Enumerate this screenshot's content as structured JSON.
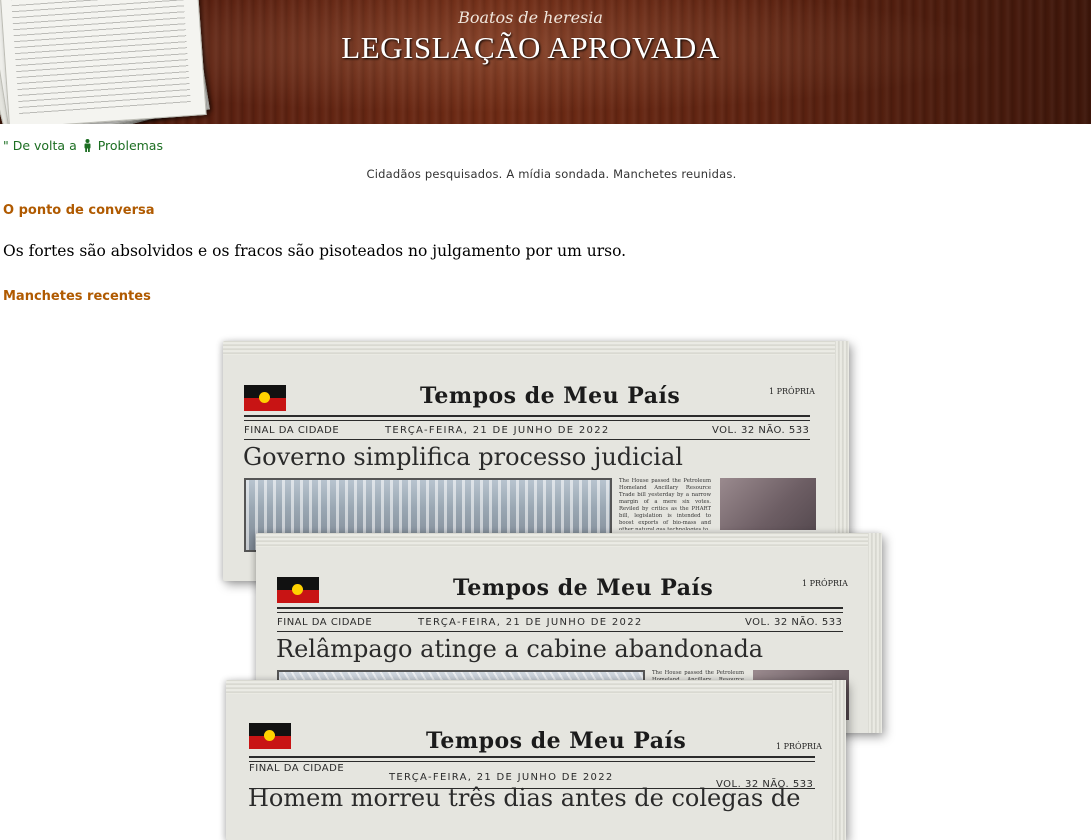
{
  "banner": {
    "subtitle": "Boatos de heresia",
    "title": "LEGISLAÇÃO APROVADA"
  },
  "nav": {
    "back_prefix": "\" De volta a",
    "back_target": "Problemas",
    "back_icon": "person-icon"
  },
  "tagline": "Cidadãos pesquisados. A mídia sondada. Manchetes reunidas.",
  "talking_point": {
    "heading": "O ponto de conversa",
    "text": "Os fortes são absolvidos e os fracos são pisoteados no julgamento por um urso."
  },
  "recent_headlines": {
    "heading": "Manchetes recentes",
    "papers": [
      {
        "masthead": "Tempos de Meu País",
        "corner": "1 PRÓPRIA",
        "edition": "FINAL DA CIDADE",
        "date": "TERÇA-FEIRA, 21 DE JUNHO DE 2022",
        "volume": "VOL. 32 NÃO. 533",
        "headline": "Governo simplifica processo judicial",
        "body": "The House passed the Petroleum Homeland Ancillary Resource Trade bill yesterday by a narrow margin of a mere six votes. Reviled by critics as the PHART bill, legislation is intended to boost exports of bio-mass and other natural gas technologies to"
      },
      {
        "masthead": "Tempos de Meu País",
        "corner": "1 PRÓPRIA",
        "edition": "FINAL DA CIDADE",
        "date": "TERÇA-FEIRA, 21 DE JUNHO DE 2022",
        "volume": "VOL. 32 NÃO. 533",
        "headline": "Relâmpago atinge a cabine abandonada",
        "body": "The House passed the Petroleum Homeland Ancillary Resource Trade bill yesterday by a narrow margin of a"
      },
      {
        "masthead": "Tempos de Meu País",
        "corner": "1 PRÓPRIA",
        "edition": "FINAL DA CIDADE",
        "date": "TERÇA-FEIRA, 21 DE JUNHO DE 2022",
        "volume": "VOL. 32 NÃO. 533",
        "headline": "Homem morreu três dias antes de colegas de"
      }
    ]
  },
  "colors": {
    "link": "#1c6e22",
    "heading": "#b05a00"
  }
}
